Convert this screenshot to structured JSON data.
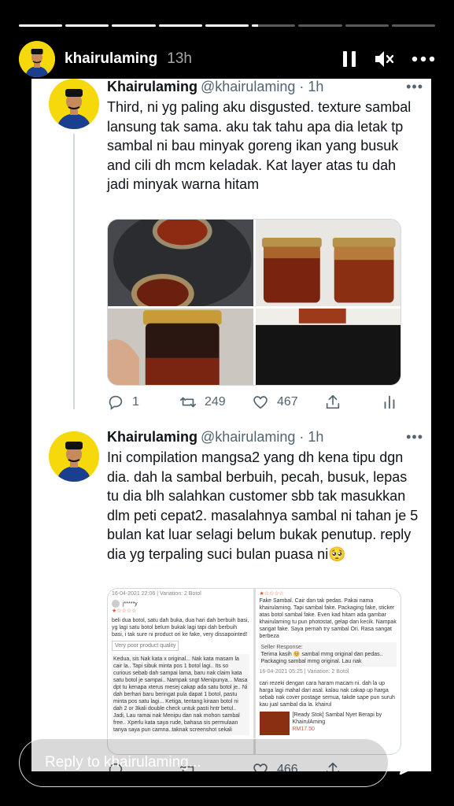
{
  "story": {
    "progress_segments": 9,
    "progress_filled": [
      1,
      1,
      1,
      1,
      1,
      0.15,
      0,
      0,
      0
    ],
    "username": "khairulaming",
    "time": "13h",
    "icons": [
      "pause-icon",
      "mute-icon",
      "more-icon"
    ]
  },
  "tweets": [
    {
      "name": "Khairulaming",
      "handle": "@khairulaming · 1h",
      "text": "Third, ni yg paling aku disgusted. texture sambal lansung tak sama. aku tak tahu apa dia letak tp sambal ni bau minyak goreng ikan yang busuk and cili dh mcm keladak. Kat layer atas tu dah jadi minyak warna hitam",
      "replies": "1",
      "retweets": "249",
      "likes": "467"
    },
    {
      "name": "Khairulaming",
      "handle": "@khairulaming · 1h",
      "text": "Ini compilation mangsa2 yang dh kena tipu dgn dia. dah la sambal berbuih, pecah, busuk, lepas tu dia blh salahkan customer sbb tak masukkan dlm peti cepat2. masalahnya sambal ni tahan je 5 bulan kat luar selagi belum bukak penutup. reply dia yg terpaling suci bulan puasa ni🥺",
      "replies": "",
      "retweets": "",
      "likes": "466",
      "screenshot_left": {
        "date": "16-04-2021 22:06 | Variation: 2 Botol",
        "user": "j*****y",
        "review": "beli dua botol, satu dah buka, dua hari dah berbuih basi, yg lagi satu botol belum bukak lagi tapi dah berbuih basi, i tak sure ni product ori ke fake, very dissapointed!",
        "tag": "Very poor product quality",
        "reply": "Kedua, sis Nak kata x original... Nak kata masam la cair la.. Tapi sibuk minta pos 1 botol lagi.. Its so curious sebab dah sampai lama, baru nak claim kata satu botol je sampai.. Nampak sngt Menipunya... Masa dpt tu kenapa xterus mesej cakap ada satu botol je.. Ni dah berhari baru beringat pula dapat 1 botol, pastu minta pos satu lagi... Ketiga, tentang kiraan botol ni dah 2 or 3kali double check untuk pasti hntr betul.. Jadi, Lau ramai nak Menipu dan nak mohon sambal free.. Xperlu kata saya rude, bahasa sis permulaan tanya saya pun camna..taknak screenshot sekali"
      },
      "screenshot_right": {
        "review": "Fake Sambal. Cair dan tak pedas. Pakai nama khairulaming. Tapi sambal fake. Packaging fake, sticker atas botol sambal fake. Even kad hitam ada gambar khairulaming tu pun photostat, gelap dan kecik. Nampak sangat fake. Saya pernah try sambal Ori. Rasa sangat berbeza",
        "seller_label": "Seller Response:",
        "seller_text": "Terima kasih 🥺 sambal mmg original dan pedas.. Packaging sambal mmg original. Lau nak",
        "date": "16-04-2021 05:25 | Variation: 2 Botol",
        "reply_text": "cari rezeki dengan cara haram macam ni. dah la up harga lagi mahal dari asal. kalau nak cakap up harga sebab nak cover postage semua, takde sape pun suruh kau jual sambal dia la. khairul",
        "product_name": "[Ready Stok] Sambal Nyet Berapi by KhairulAming",
        "product_price": "RM17.50"
      }
    }
  ],
  "reply_bar": {
    "placeholder": "Reply to khairulaming..."
  },
  "colors": {
    "avatar_bg": "#f5d90b",
    "tweet_text": "#0f1419",
    "muted": "#536471",
    "star": "#ee4d2d"
  }
}
